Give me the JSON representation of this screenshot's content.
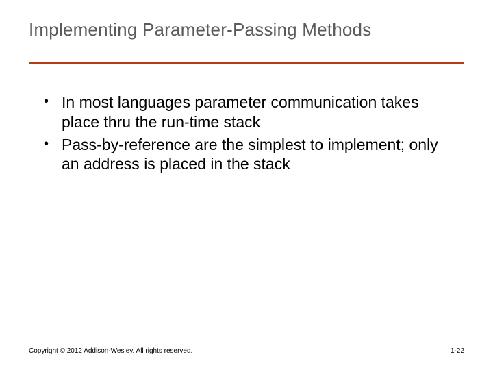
{
  "title": "Implementing Parameter-Passing Methods",
  "bullets": [
    "In most languages parameter communication takes place thru the run-time stack",
    "Pass-by-reference are the simplest to implement; only an address is placed in the stack"
  ],
  "footer": {
    "copyright": "Copyright © 2012 Addison-Wesley. All rights reserved.",
    "page": "1-22"
  },
  "colors": {
    "rule": "#b33c1a",
    "title": "#5b5b5b"
  }
}
